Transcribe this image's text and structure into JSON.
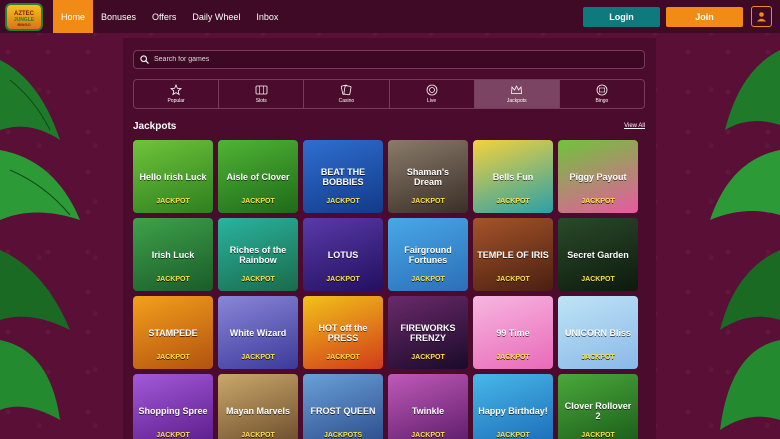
{
  "nav": {
    "logo_text": "AZTEC JUNGLE BINGO",
    "items": [
      {
        "label": "Home",
        "active": true
      },
      {
        "label": "Bonuses",
        "active": false
      },
      {
        "label": "Offers",
        "active": false
      },
      {
        "label": "Daily Wheel",
        "active": false
      },
      {
        "label": "Inbox",
        "active": false
      }
    ]
  },
  "auth": {
    "login_label": "Login",
    "join_label": "Join",
    "user_icon": "user-icon"
  },
  "search": {
    "placeholder": "Search for games",
    "icon": "search-icon"
  },
  "categories": [
    {
      "label": "Popular",
      "icon": "star-icon",
      "active": false
    },
    {
      "label": "Slots",
      "icon": "slot-machine-icon",
      "active": false
    },
    {
      "label": "Casino",
      "icon": "cards-icon",
      "active": false
    },
    {
      "label": "Live",
      "icon": "chip-icon",
      "active": false
    },
    {
      "label": "Jackpots",
      "icon": "crown-icon",
      "active": true
    },
    {
      "label": "Bingo",
      "icon": "bingo-icon",
      "active": false
    }
  ],
  "section": {
    "title": "Jackpots",
    "view_all": "View All"
  },
  "games": [
    {
      "title": "Hello Irish Luck",
      "sub": "JACKPOT",
      "colors": [
        "#6fc43a",
        "#2e7f1f"
      ]
    },
    {
      "title": "Aisle of Clover",
      "sub": "JACKPOT",
      "colors": [
        "#4fb434",
        "#1f6a1a"
      ]
    },
    {
      "title": "BEAT THE BOBBIES",
      "sub": "JACKPOT",
      "colors": [
        "#2f6fd0",
        "#123a8a"
      ]
    },
    {
      "title": "Shaman's Dream",
      "sub": "JACKPOT",
      "colors": [
        "#8a7b6a",
        "#3a2f28"
      ]
    },
    {
      "title": "Bells Fun",
      "sub": "JACKPOT",
      "colors": [
        "#f4d23c",
        "#2aa0a8"
      ]
    },
    {
      "title": "Piggy Payout",
      "sub": "JACKPOT",
      "colors": [
        "#6fc43a",
        "#e75aa0"
      ]
    },
    {
      "title": "Irish Luck",
      "sub": "JACKPOT",
      "colors": [
        "#3ea24a",
        "#1a5c2a"
      ]
    },
    {
      "title": "Riches of the Rainbow",
      "sub": "JACKPOT",
      "colors": [
        "#2ab3a0",
        "#1a6b4a"
      ]
    },
    {
      "title": "LOTUS",
      "sub": "JACKPOT",
      "colors": [
        "#5a3aa8",
        "#221060"
      ]
    },
    {
      "title": "Fairground Fortunes",
      "sub": "JACKPOT",
      "colors": [
        "#48a8e8",
        "#2b6fb8"
      ]
    },
    {
      "title": "TEMPLE OF IRIS",
      "sub": "JACKPOT",
      "colors": [
        "#a5542a",
        "#4a1f10"
      ]
    },
    {
      "title": "Secret Garden",
      "sub": "JACKPOT",
      "colors": [
        "#2a4a2a",
        "#0d1a0d"
      ]
    },
    {
      "title": "STAMPEDE",
      "sub": "JACKPOT",
      "colors": [
        "#f3a01c",
        "#b2520f"
      ]
    },
    {
      "title": "White Wizard",
      "sub": "JACKPOT",
      "colors": [
        "#8a86d8",
        "#3c3a9a"
      ]
    },
    {
      "title": "HOT off the PRESS",
      "sub": "JACKPOT",
      "colors": [
        "#f2c21a",
        "#d13b1a"
      ]
    },
    {
      "title": "FIREWORKS FRENZY",
      "sub": "JACKPOT",
      "colors": [
        "#6a2a6a",
        "#1a0a2a"
      ]
    },
    {
      "title": "99 Time",
      "sub": "JACKPOT",
      "colors": [
        "#f7b6e0",
        "#e86ab8"
      ]
    },
    {
      "title": "UNICORN Bliss",
      "sub": "JACKPOT",
      "colors": [
        "#bfe4f6",
        "#8ab8e8"
      ]
    },
    {
      "title": "Shopping Spree",
      "sub": "JACKPOT",
      "colors": [
        "#a25ad8",
        "#5a1a8a"
      ]
    },
    {
      "title": "Mayan Marvels",
      "sub": "JACKPOT",
      "colors": [
        "#caa86a",
        "#6a4a2a"
      ]
    },
    {
      "title": "FROST QUEEN",
      "sub": "JACKPOTS",
      "colors": [
        "#6aa0d8",
        "#2a4a8a"
      ]
    },
    {
      "title": "Twinkle",
      "sub": "JACKPOT",
      "colors": [
        "#c05ab8",
        "#5a1a6a"
      ]
    },
    {
      "title": "Happy Birthday!",
      "sub": "JACKPOT",
      "colors": [
        "#48b8e8",
        "#1a6ab8"
      ]
    },
    {
      "title": "Clover Rollover 2",
      "sub": "JACKPOT",
      "colors": [
        "#4aa83a",
        "#1a5a1a"
      ]
    }
  ],
  "theme": {
    "accent": "#f28b16",
    "login": "#0f7a7d",
    "background": "#5a0f36"
  }
}
